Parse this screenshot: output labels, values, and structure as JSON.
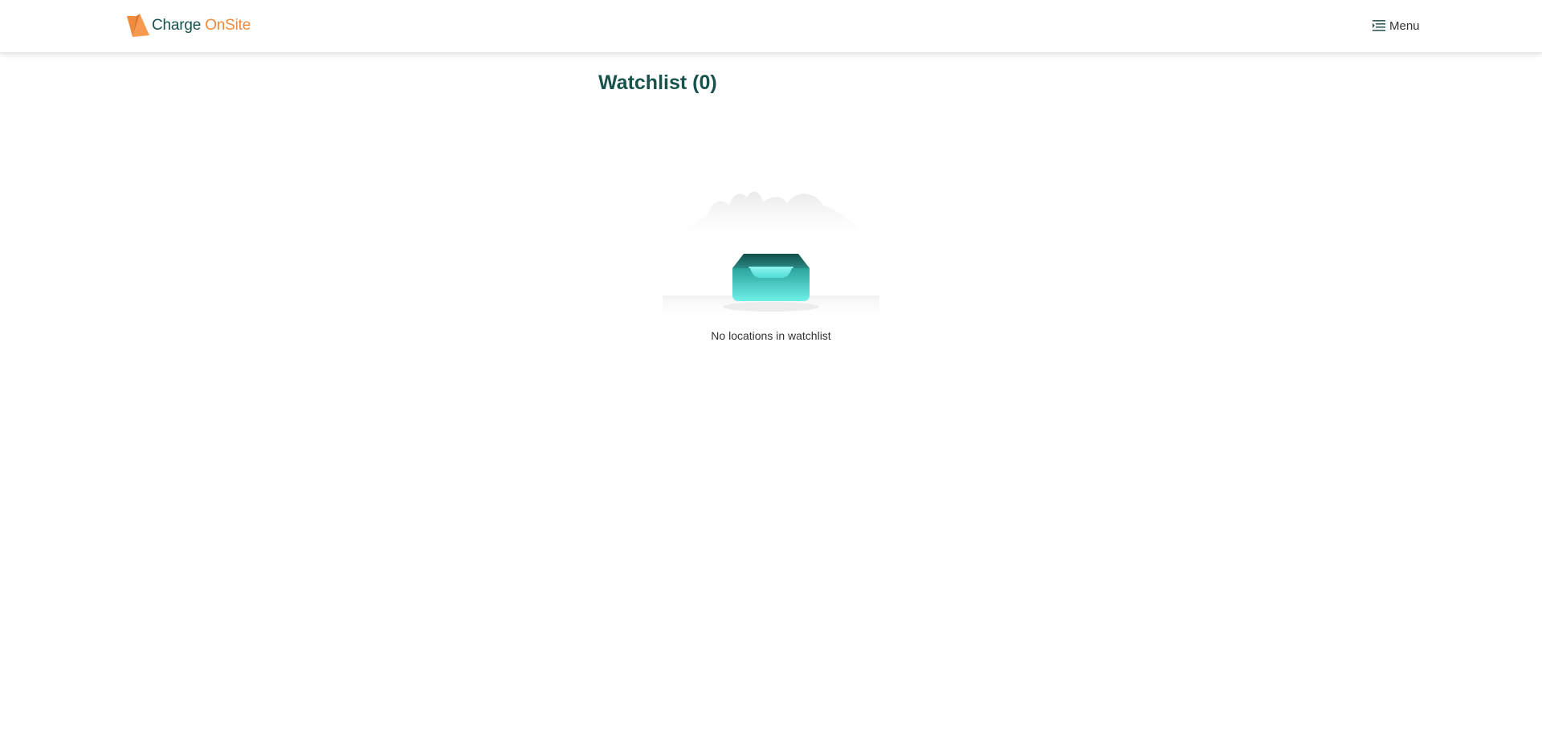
{
  "header": {
    "brand_part1": "Charge",
    "brand_part2": "OnSite",
    "menu_label": "Menu"
  },
  "main": {
    "title": "Watchlist (0)",
    "empty_message": "No locations in watchlist"
  },
  "icons": {
    "logo": "logo-mark-icon",
    "menu": "menu-lines-icon",
    "empty_state": "empty-inbox-tray-icon"
  },
  "colors": {
    "brand_dark": "#17534c",
    "brand_accent": "#f08a3c",
    "tray_dark": "#1d6e67",
    "tray_light": "#5fe3dc"
  }
}
